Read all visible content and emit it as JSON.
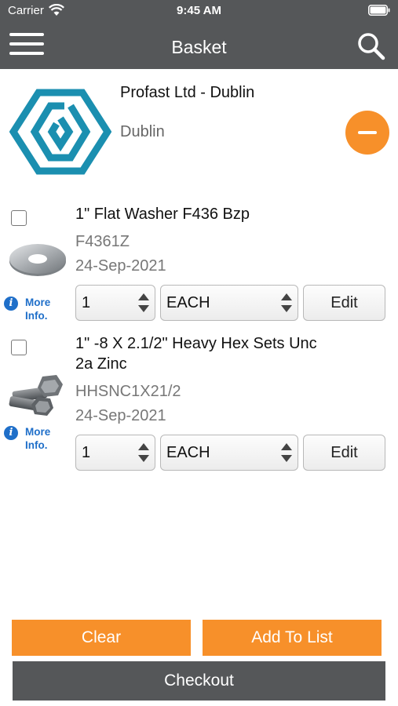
{
  "status_bar": {
    "carrier": "Carrier",
    "time": "9:45 AM"
  },
  "nav": {
    "title": "Basket",
    "menu_icon": "hamburger-menu-icon",
    "search_icon": "search-icon"
  },
  "customer": {
    "name": "Profast Ltd - Dublin",
    "city": "Dublin",
    "logo_color": "#1b8fb0",
    "remove_icon": "minus-circle-icon"
  },
  "items": [
    {
      "title": "1\" Flat Washer F436 Bzp",
      "code": "F4361Z",
      "date": "24-Sep-2021",
      "quantity": "1",
      "uom": "EACH",
      "edit_label": "Edit",
      "more_info_label": "More Info.",
      "image": "flat-washer"
    },
    {
      "title": "1\" -8 X 2.1/2\" Heavy Hex Sets Unc 2a Zinc",
      "code": "HHSNC1X21/2",
      "date": "24-Sep-2021",
      "quantity": "1",
      "uom": "EACH",
      "edit_label": "Edit",
      "more_info_label": "More Info.",
      "image": "hex-bolts"
    }
  ],
  "actions": {
    "clear_label": "Clear",
    "add_to_list_label": "Add To List",
    "checkout_label": "Checkout"
  },
  "colors": {
    "accent_orange": "#f7902a",
    "bar_gray": "#555759",
    "link_blue": "#1f6fc9"
  }
}
